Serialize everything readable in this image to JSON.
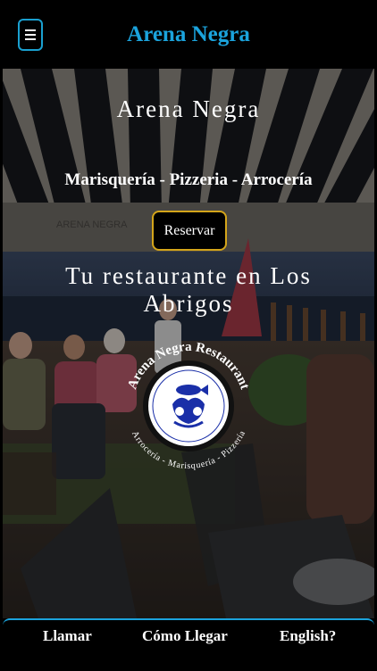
{
  "header": {
    "title": "Arena Negra",
    "menu_icon": "hamburger-menu-icon"
  },
  "hero": {
    "title": "Arena Negra",
    "subtitle": "Marisquería - Pizzeria - Arrocería",
    "reserve_button": "Reservar",
    "tagline": "Tu restaurante en Los Abrigos",
    "logo": {
      "top_text": "Arena Negra Restaurant",
      "bottom_text": "Arrocería - Marisquería - Pizzería"
    }
  },
  "footer_nav": {
    "call": "Llamar",
    "directions": "Cómo Llegar",
    "language": "English?"
  },
  "colors": {
    "accent": "#1ba3dc",
    "button_border": "#d4a51a",
    "background": "#000000"
  }
}
